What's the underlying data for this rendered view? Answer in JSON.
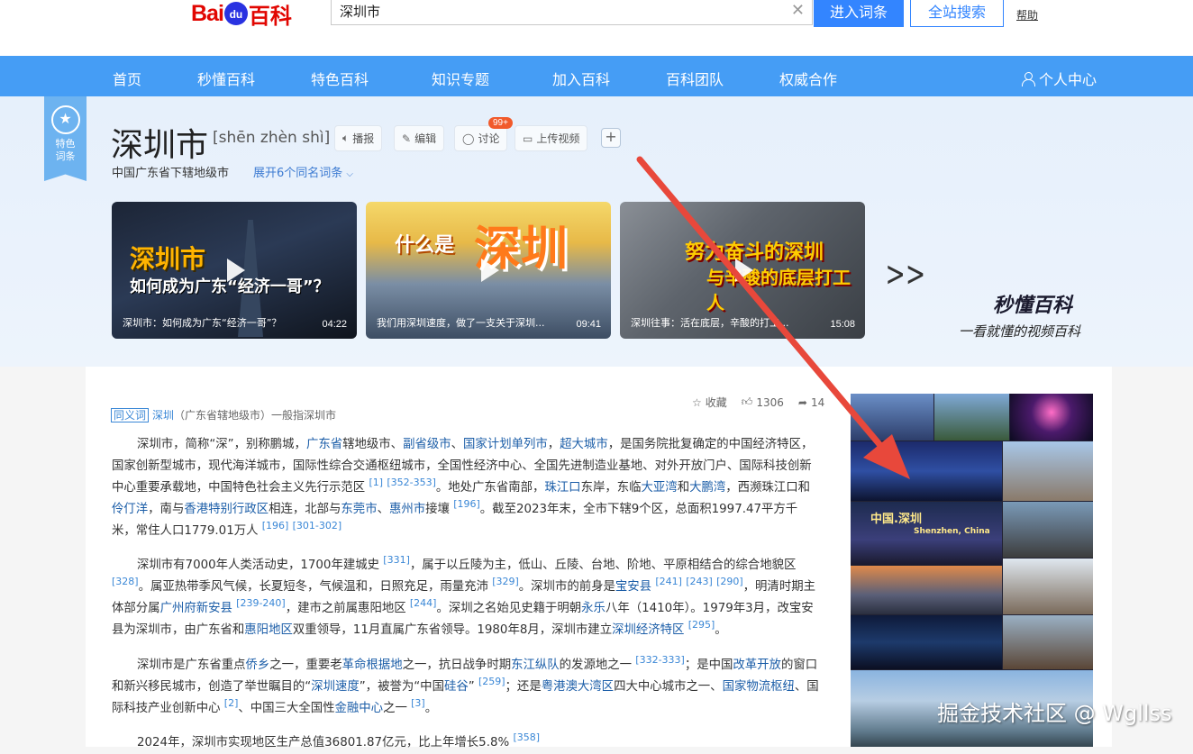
{
  "header": {
    "logo_bai": "Bai",
    "logo_du": "du",
    "logo_baike": "百科",
    "search_value": "深圳市",
    "enter_label": "进入词条",
    "site_search_label": "全站搜索",
    "help_label": "帮助"
  },
  "nav": {
    "items": [
      "首页",
      "秒懂百科",
      "特色百科",
      "知识专题",
      "加入百科",
      "百科团队",
      "权威合作"
    ],
    "user_label": "个人中心"
  },
  "lemma": {
    "tese_line1": "特色",
    "tese_line2": "词条",
    "title": "深圳市",
    "pinyin": "[shēn zhèn shì]",
    "tools": {
      "play": "播报",
      "edit": "编辑",
      "discuss": "讨论",
      "discuss_badge": "99+",
      "upload": "上传视频",
      "plus": "+"
    },
    "subtitle": "中国广东省下辖地级市",
    "expand": "展开6个同名词条"
  },
  "videos": [
    {
      "big": "深圳市",
      "mid": "如何成为广东“经济一哥”？",
      "title": "深圳市：如何成为广东“经济一哥”？",
      "duration": "04:22"
    },
    {
      "big": "深圳",
      "mid": "什么是",
      "title": "我们用深圳速度，做了一支关于深圳...",
      "duration": "09:41"
    },
    {
      "big": "努力奋斗的深圳",
      "mid": "与辛酸的底层打工人",
      "title": "深圳往事：活在底层，辛酸的打工...",
      "duration": "15:08"
    }
  ],
  "miaodong": {
    "logo": "秒懂百科",
    "slogan": "一看就懂的视频百科"
  },
  "synonym": {
    "tag": "同义词",
    "link": "深圳",
    "rest": "（广东省辖地级市）一般指深圳市"
  },
  "actions": {
    "collect": "收藏",
    "likes": "1306",
    "share": "14"
  },
  "collage": {
    "caption": "中国.深圳",
    "caption_en": "Shenzhen, China"
  },
  "watermark": "掘金技术社区 @ Wgllss",
  "colors": {
    "nav": "#459df5",
    "accent": "#3385ff",
    "link": "#1c5ea8",
    "badge": "#f15a2b",
    "arrow": "#e8483b"
  }
}
